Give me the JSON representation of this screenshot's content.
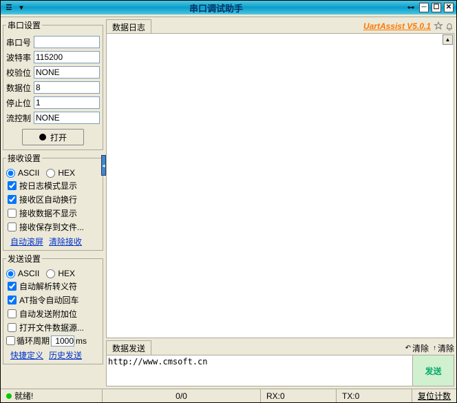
{
  "window": {
    "title": "串口调试助手"
  },
  "brand": "UartAssist V5.0.1",
  "port_settings": {
    "legend": "串口设置",
    "port_label": "串口号",
    "port_value": "",
    "baud_label": "波特率",
    "baud_value": "115200",
    "parity_label": "校验位",
    "parity_value": "NONE",
    "databits_label": "数据位",
    "databits_value": "8",
    "stopbits_label": "停止位",
    "stopbits_value": "1",
    "flow_label": "流控制",
    "flow_value": "NONE",
    "open_label": "打开"
  },
  "recv_settings": {
    "legend": "接收设置",
    "ascii": "ASCII",
    "hex": "HEX",
    "chk_logmode": "按日志模式显示",
    "chk_autowrap": "接收区自动换行",
    "chk_hide_recv": "接收数据不显示",
    "chk_save_file": "接收保存到文件...",
    "link_autoscroll": "自动滚屏",
    "link_clear_recv": "清除接收"
  },
  "send_settings": {
    "legend": "发送设置",
    "ascii": "ASCII",
    "hex": "HEX",
    "chk_escape": "自动解析转义符",
    "chk_at_cr": "AT指令自动回车",
    "chk_append": "自动发送附加位",
    "chk_file_src": "打开文件数据源...",
    "chk_cycle": "循环周期",
    "cycle_value": "1000",
    "cycle_unit": "ms",
    "link_shortcut": "快捷定义",
    "link_history": "历史发送"
  },
  "log": {
    "tab": "数据日志"
  },
  "send": {
    "tab": "数据发送",
    "clear1": "清除",
    "clear2": "清除",
    "input": "http://www.cmsoft.cn",
    "button": "发送"
  },
  "status": {
    "ready": "就绪!",
    "mid": "0/0",
    "rx": "RX:0",
    "tx": "TX:0",
    "reset": "复位计数"
  }
}
